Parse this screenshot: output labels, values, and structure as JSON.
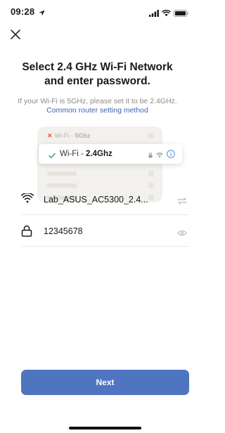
{
  "status_bar": {
    "time": "09:28",
    "icons": [
      "location-arrow-icon",
      "signal-bars-icon",
      "wifi-icon",
      "battery-icon"
    ]
  },
  "header": {
    "close_icon": "close-icon"
  },
  "title": "Select 2.4 GHz Wi-Fi Network and enter password.",
  "subtitle": {
    "text": "If your Wi-Fi is 5GHz, please set it to be 2.4GHz.",
    "link": "Common router setting method"
  },
  "illustration": {
    "bad_option_prefix": "Wi-Fi - ",
    "bad_option_band": "5Ghz",
    "good_option_prefix": "Wi-Fi - ",
    "good_option_band": "2.4Ghz"
  },
  "network_field": {
    "value": "Lab_ASUS_AC5300_2.4...",
    "icon": "wifi-icon",
    "action_icon": "switch-network-icon"
  },
  "password_field": {
    "value": "12345678",
    "icon": "lock-icon",
    "action_icon": "eye-icon"
  },
  "next_button": {
    "label": "Next"
  },
  "colors": {
    "accent": "#4f74c0",
    "link": "#3d63b5",
    "error": "#e2524f",
    "success": "#3aa35a"
  }
}
